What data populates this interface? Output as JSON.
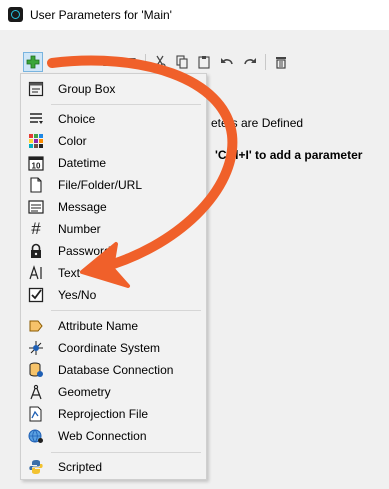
{
  "window": {
    "title": "User Parameters for 'Main'"
  },
  "toolbar": {
    "items": [
      "add-icon",
      "move-up-icon",
      "move-down-icon",
      "move-top-icon",
      "move-bottom-icon",
      "cut-icon",
      "copy-icon",
      "paste-icon",
      "undo-icon",
      "redo-icon",
      "delete-icon"
    ]
  },
  "background": {
    "line1": "eters are Defined",
    "line2": "'Ctrl+I' to add a parameter"
  },
  "menu": {
    "group_box": "Group Box",
    "choice": "Choice",
    "color": "Color",
    "datetime": "Datetime",
    "datetime_icon_text": "10",
    "file": "File/Folder/URL",
    "message": "Message",
    "number": "Number",
    "password": "Password",
    "text": "Text",
    "yesno": "Yes/No",
    "attribute_name": "Attribute Name",
    "coordinate_system": "Coordinate System",
    "database_connection": "Database Connection",
    "geometry": "Geometry",
    "reprojection_file": "Reprojection File",
    "web_connection": "Web Connection",
    "scripted": "Scripted"
  },
  "colors": {
    "annotation_arrow": "#f0602a",
    "add_green": "#3aa63a",
    "hover_bg": "#cfe6f7"
  }
}
